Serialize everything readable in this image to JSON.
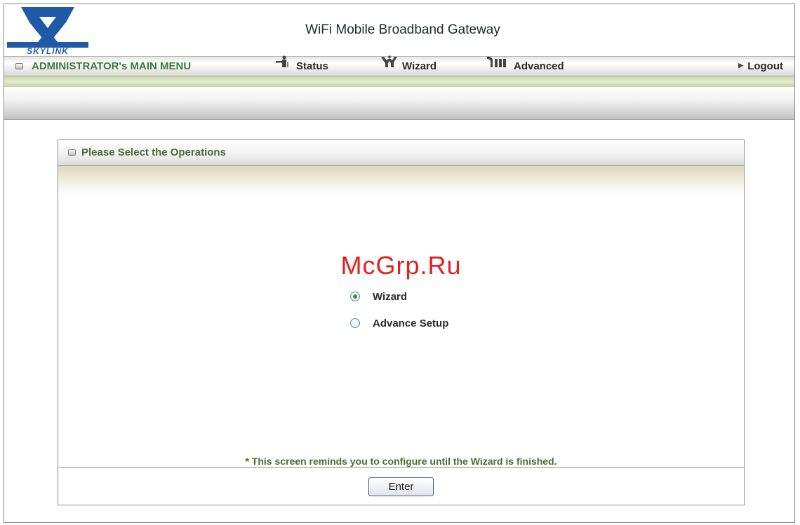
{
  "header": {
    "logo_text": "SKYLINK",
    "title": "WiFi Mobile Broadband Gateway"
  },
  "nav": {
    "admin_label": "ADMINISTRATOR's MAIN MENU",
    "status_label": "Status",
    "wizard_label": "Wizard",
    "advanced_label": "Advanced",
    "logout_label": "Logout"
  },
  "panel": {
    "title": "Please Select the Operations",
    "watermark": "McGrp.Ru",
    "options": [
      {
        "label": "Wizard",
        "selected": true
      },
      {
        "label": "Advance Setup",
        "selected": false
      }
    ],
    "reminder": "* This screen reminds you to configure until the Wizard is finished.",
    "enter_label": "Enter"
  },
  "colors": {
    "brand_blue": "#1f5aa6",
    "accent_green": "#4b6b2b",
    "watermark_red": "#e0201c"
  },
  "icons": {
    "status": "person-icon",
    "wizard": "wizard-icon",
    "advanced": "tools-icon",
    "logout": "triangle-right-icon"
  }
}
